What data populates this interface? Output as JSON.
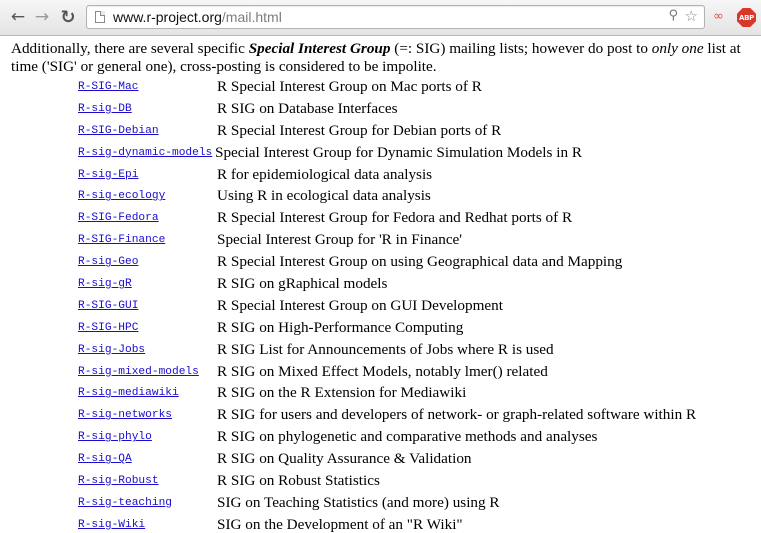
{
  "browser": {
    "url_host": "www.r-project.org",
    "url_path": "/mail.html",
    "abp_label": "ABP",
    "icons": {
      "back": "back-arrow-icon",
      "forward": "forward-arrow-icon",
      "reload": "reload-icon",
      "page": "page-icon",
      "zoom": "zoom-icon",
      "bookmark": "star-icon",
      "share": "share-icon",
      "adblock": "adblock-plus-icon"
    }
  },
  "intro": {
    "t1": "Additionally, there are several specific ",
    "bi": "Special Interest Group",
    "t2": " (=: SIG) mailing lists; however do post to ",
    "it": "only one",
    "t3": " list at time ('SIG' or general one), cross-posting is considered to be impolite."
  },
  "lists": [
    {
      "name": "R-SIG-Mac",
      "description": "R Special Interest Group on Mac ports of R"
    },
    {
      "name": "R-sig-DB",
      "description": "R SIG on Database Interfaces"
    },
    {
      "name": "R-SIG-Debian",
      "description": "R Special Interest Group for Debian ports of R"
    },
    {
      "name": "R-sig-dynamic-models",
      "description": "Special Interest Group for Dynamic Simulation Models in R"
    },
    {
      "name": "R-sig-Epi",
      "description": "R for epidemiological data analysis"
    },
    {
      "name": "R-sig-ecology",
      "description": "Using R in ecological data analysis"
    },
    {
      "name": "R-SIG-Fedora",
      "description": "R Special Interest Group for Fedora and Redhat ports of R"
    },
    {
      "name": "R-SIG-Finance",
      "description": "Special Interest Group for 'R in Finance'"
    },
    {
      "name": "R-sig-Geo",
      "description": "R Special Interest Group on using Geographical data and Mapping"
    },
    {
      "name": "R-sig-gR",
      "description": "R SIG on gRaphical models"
    },
    {
      "name": "R-SIG-GUI",
      "description": "R Special Interest Group on GUI Development"
    },
    {
      "name": "R-SIG-HPC",
      "description": "R SIG on High-Performance Computing"
    },
    {
      "name": "R-sig-Jobs",
      "description": "R SIG List for Announcements of Jobs where R is used"
    },
    {
      "name": "R-sig-mixed-models",
      "description": "R SIG on Mixed Effect Models, notably lmer() related"
    },
    {
      "name": "R-sig-mediawiki",
      "description": "R SIG on the R Extension for Mediawiki"
    },
    {
      "name": "R-sig-networks",
      "description": "R SIG for users and developers of network- or graph-related software within R"
    },
    {
      "name": "R-sig-phylo",
      "description": "R SIG on phylogenetic and comparative methods and analyses"
    },
    {
      "name": "R-sig-QA",
      "description": "R SIG on Quality Assurance & Validation"
    },
    {
      "name": "R-sig-Robust",
      "description": "R SIG on Robust Statistics"
    },
    {
      "name": "R-sig-teaching",
      "description": "SIG on Teaching Statistics (and more) using R"
    },
    {
      "name": "R-sig-Wiki",
      "description": "SIG on the Development of an \"R Wiki\""
    }
  ]
}
